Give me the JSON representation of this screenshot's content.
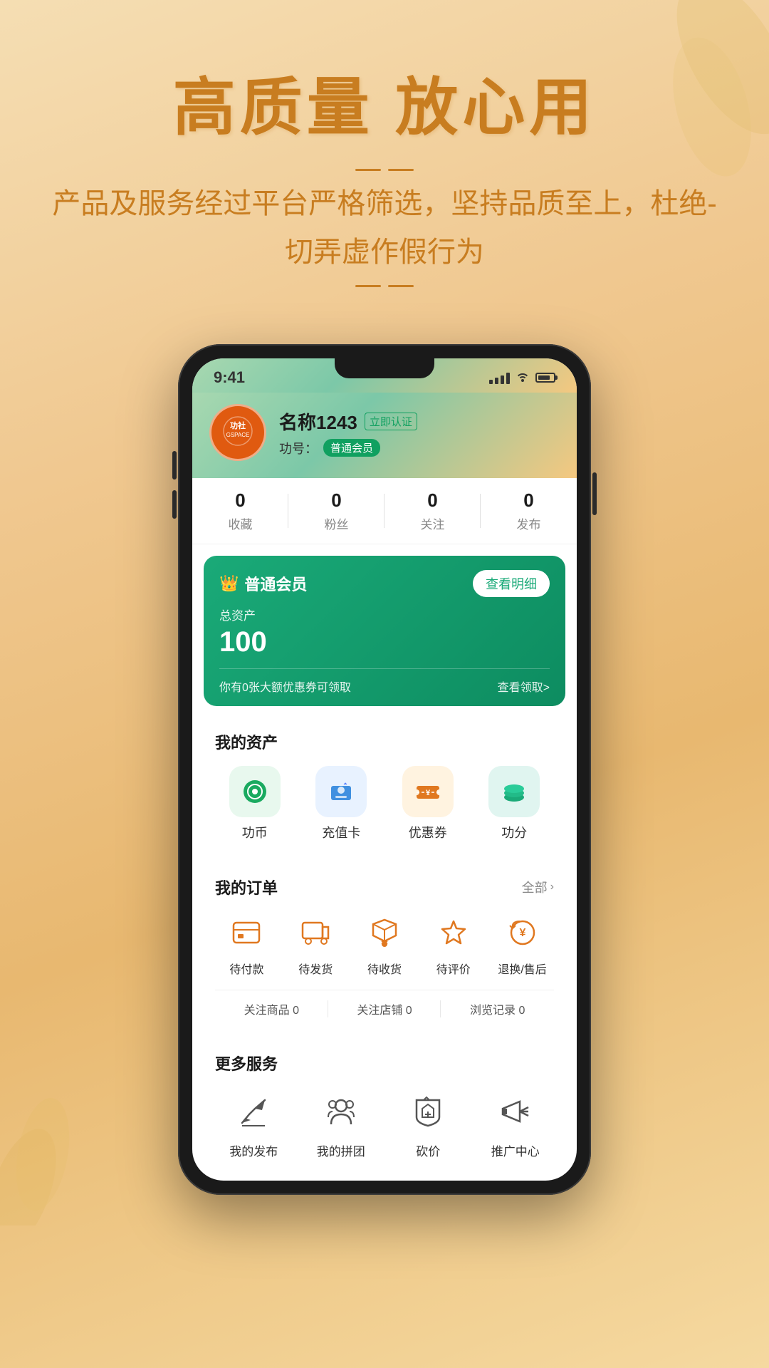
{
  "background": {
    "gradient_start": "#f5deb3",
    "gradient_end": "#e8b870"
  },
  "top_section": {
    "main_title": "高质量 放心用",
    "sub_text": "产品及服务经过平台严格筛选，坚持品质至上，杜绝-切弄虚作假行为"
  },
  "status_bar": {
    "time": "9:41"
  },
  "profile": {
    "name": "名称1243",
    "verify_label": "立即认证",
    "id_label": "功号：",
    "member_type": "普通会员",
    "avatar_icon": "G",
    "avatar_sub": "功社",
    "stats": [
      {
        "num": "0",
        "label": "收藏"
      },
      {
        "num": "0",
        "label": "粉丝"
      },
      {
        "num": "0",
        "label": "关注"
      },
      {
        "num": "0",
        "label": "发布"
      }
    ]
  },
  "member_card": {
    "type": "普通会员",
    "asset_label": "总资产",
    "asset_amount": "100",
    "view_detail_label": "查看明细",
    "coupon_text": "你有0张大额优惠券可领取",
    "coupon_link": "查看领取>"
  },
  "my_assets": {
    "section_title": "我的资产",
    "items": [
      {
        "icon": "💰",
        "label": "功币",
        "color_class": "green"
      },
      {
        "icon": "💳",
        "label": "充值卡",
        "color_class": "blue"
      },
      {
        "icon": "🎫",
        "label": "优惠券",
        "color_class": "orange"
      },
      {
        "icon": "🗄️",
        "label": "功分",
        "color_class": "teal"
      }
    ]
  },
  "my_orders": {
    "section_title": "我的订单",
    "all_label": "全部",
    "items": [
      {
        "icon": "💼",
        "label": "待付款"
      },
      {
        "icon": "📦",
        "label": "待发货"
      },
      {
        "icon": "🚚",
        "label": "待收货"
      },
      {
        "icon": "⭐",
        "label": "待评价"
      },
      {
        "icon": "↩️",
        "label": "退换/售后"
      }
    ],
    "favorites": [
      {
        "label": "关注商品 0"
      },
      {
        "label": "关注店铺 0"
      },
      {
        "label": "浏览记录 0"
      }
    ]
  },
  "more_services": {
    "section_title": "更多服务",
    "items": [
      {
        "icon": "✈",
        "label": "我的发布"
      },
      {
        "icon": "👥",
        "label": "我的拼团"
      },
      {
        "icon": "🔖",
        "label": "砍价"
      },
      {
        "icon": "📢",
        "label": "推广中心"
      }
    ]
  }
}
